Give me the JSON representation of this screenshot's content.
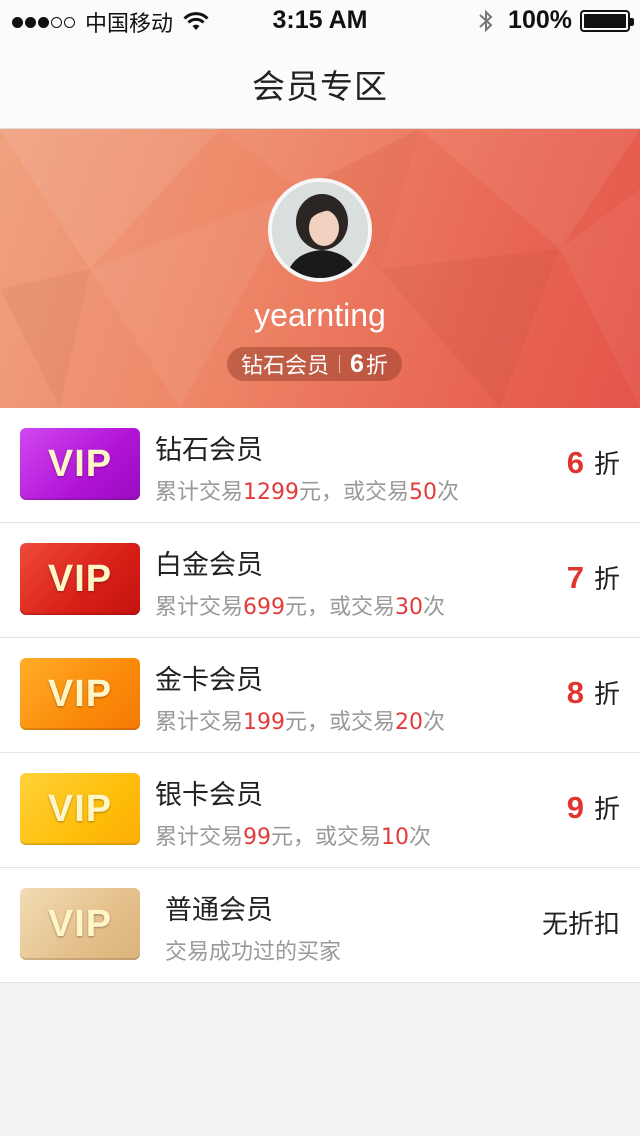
{
  "status_bar": {
    "carrier": "中国移动",
    "time": "3:15 AM",
    "battery": "100%"
  },
  "nav": {
    "title": "会员专区"
  },
  "profile": {
    "username": "yearnting",
    "level": "钻石会员",
    "discount_value": "6",
    "discount_unit": "折"
  },
  "tiers": [
    {
      "vip_label": "VIP",
      "name": "钻石会员",
      "desc_prefix": "累计交易",
      "amount": "1299",
      "desc_mid": "元，或交易",
      "count": "50",
      "desc_suffix": "次",
      "discount": "6",
      "unit": "折",
      "color": "#b31adc"
    },
    {
      "vip_label": "VIP",
      "name": "白金会员",
      "desc_prefix": "累计交易",
      "amount": "699",
      "desc_mid": "元，或交易",
      "count": "30",
      "desc_suffix": "次",
      "discount": "7",
      "unit": "折",
      "color": "#d81f17"
    },
    {
      "vip_label": "VIP",
      "name": "金卡会员",
      "desc_prefix": "累计交易",
      "amount": "199",
      "desc_mid": "元，或交易",
      "count": "20",
      "desc_suffix": "次",
      "discount": "8",
      "unit": "折",
      "color": "#fb8a0a"
    },
    {
      "vip_label": "VIP",
      "name": "银卡会员",
      "desc_prefix": "累计交易",
      "amount": "99",
      "desc_mid": "元，或交易",
      "count": "10",
      "desc_suffix": "次",
      "discount": "9",
      "unit": "折",
      "color": "#ffbe0a"
    },
    {
      "vip_label": "VIP",
      "name": "普通会员",
      "desc": "交易成功过的买家",
      "discount_text": "无折扣",
      "color": "#e4c08b"
    }
  ],
  "accent_color": "#e0352f"
}
